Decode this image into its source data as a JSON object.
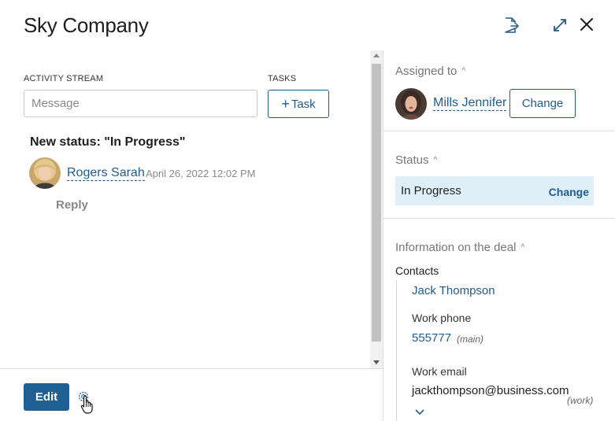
{
  "header": {
    "title": "Sky Company",
    "icons": [
      "export-icon",
      "expand-icon",
      "close-icon"
    ]
  },
  "left": {
    "activity_label": "ACTIVITY STREAM",
    "tasks_label": "TASKS",
    "message_placeholder": "Message",
    "task_button_plus": "+",
    "task_button_label": "Task",
    "entry": {
      "heading": "New status: \"In Progress\"",
      "author": "Rogers Sarah",
      "timestamp": "April 26, 2022 12:02 PM",
      "reply_label": "Reply"
    }
  },
  "footer": {
    "edit_label": "Edit"
  },
  "right": {
    "assigned": {
      "heading": "Assigned to",
      "caret": "^",
      "person": "Mills Jennifer",
      "change_label": "Change"
    },
    "status": {
      "heading": "Status",
      "caret": "^",
      "value": "In Progress",
      "change_label": "Change"
    },
    "info": {
      "heading": "Information on the deal",
      "caret": "^",
      "contacts_label": "Contacts",
      "contact_name": "Jack Thompson",
      "phone_label": "Work phone",
      "phone_value": "555777",
      "phone_type": "(main)",
      "email_label": "Work email",
      "email_value": "jackthompson@business.com",
      "email_type": "(work)"
    }
  },
  "colors": {
    "accent": "#235c8c",
    "primary_button": "#1f5f94",
    "status_bg": "#deeff8"
  }
}
